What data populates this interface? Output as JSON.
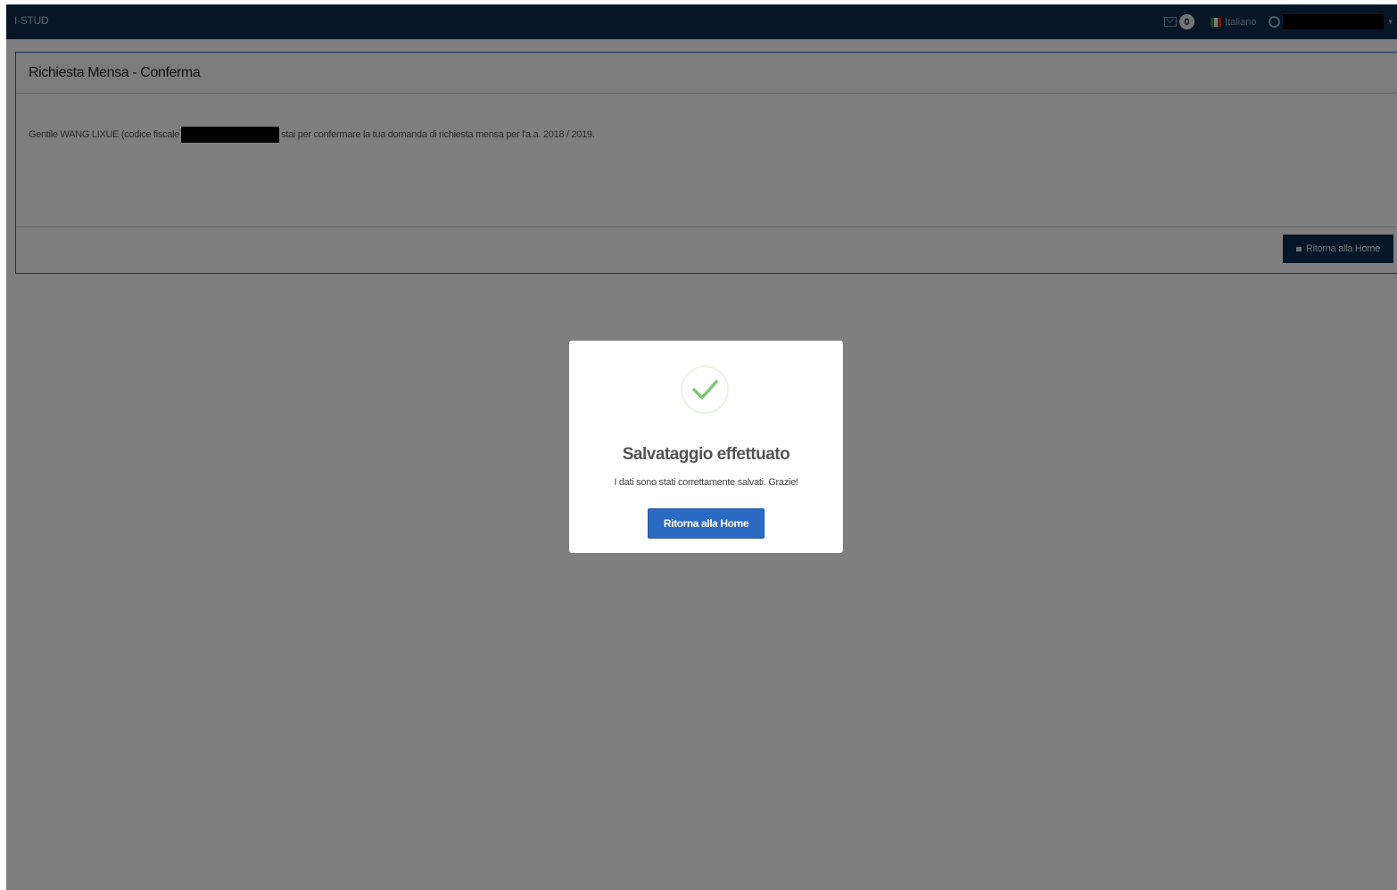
{
  "topbar": {
    "brand": "I-STUD",
    "mail_count": "0",
    "language": "Italiano",
    "flag_colors": [
      "#2e8b3a",
      "#f4f4f4",
      "#c8302e"
    ]
  },
  "panel": {
    "title": "Richiesta Mensa - Conferma",
    "body_text_before": "Gentile WANG LIXUE (codice fiscale",
    "body_text_after": "stai per confermare la tua domanda di richiesta mensa per l'a.a. 2018 / 2019.",
    "home_button_label": "Ritorna alla Home"
  },
  "modal": {
    "title": "Salvataggio effettuato",
    "message": "I dati sono stati correttamente salvati. Grazie!",
    "button_label": "Ritorna alla Home",
    "success_color": "#7cc86e"
  },
  "colors": {
    "navbar": "#0c2c4c",
    "primary_button": "#2a6ac2",
    "panel_border": "#2d5aa8"
  }
}
